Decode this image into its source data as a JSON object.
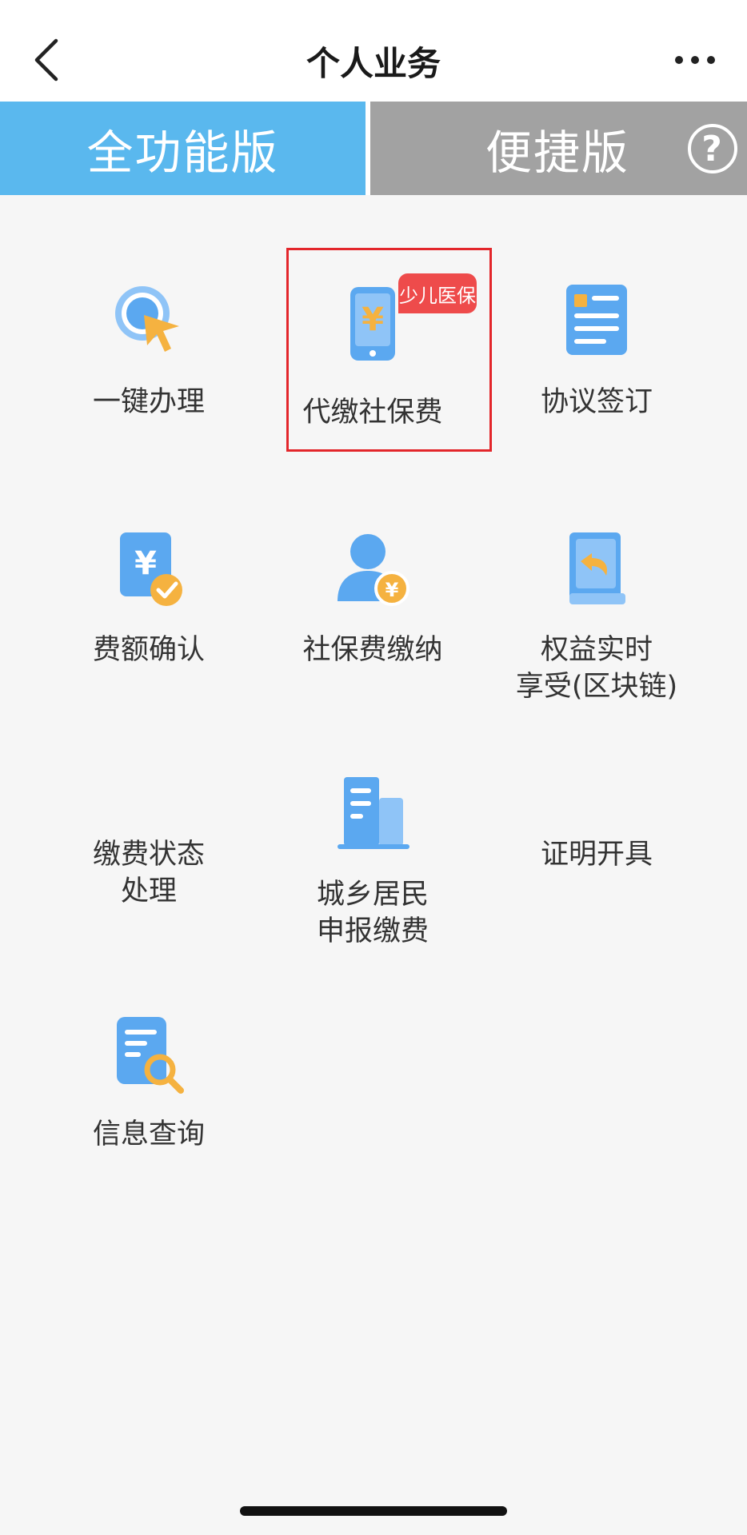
{
  "navbar": {
    "title": "个人业务"
  },
  "tabs": {
    "full": "全功能版",
    "quick": "便捷版",
    "help_glyph": "?"
  },
  "items": [
    {
      "label": "一键办理",
      "icon": "one-click-cursor-icon"
    },
    {
      "label": "代缴社保费",
      "icon": "phone-yuan-icon",
      "badge": "少儿医保"
    },
    {
      "label": "协议签订",
      "icon": "document-icon"
    },
    {
      "label": "费额确认",
      "icon": "yuan-check-icon"
    },
    {
      "label": "社保费缴纳",
      "icon": "user-yuan-icon"
    },
    {
      "label": "权益实时\n享受(区块链)",
      "icon": "book-return-icon"
    },
    {
      "label": "缴费状态\n处理",
      "icon": ""
    },
    {
      "label": "城乡居民\n申报缴费",
      "icon": "building-icon"
    },
    {
      "label": "证明开具",
      "icon": ""
    },
    {
      "label": "信息查询",
      "icon": "doc-search-icon"
    }
  ],
  "colors": {
    "tab_active": "#5ab8ee",
    "tab_inactive": "#a2a2a2",
    "badge": "#ee4b4b",
    "highlight": "#e3262b",
    "icon_blue": "#5ba8f0",
    "icon_orange": "#f5b240"
  }
}
